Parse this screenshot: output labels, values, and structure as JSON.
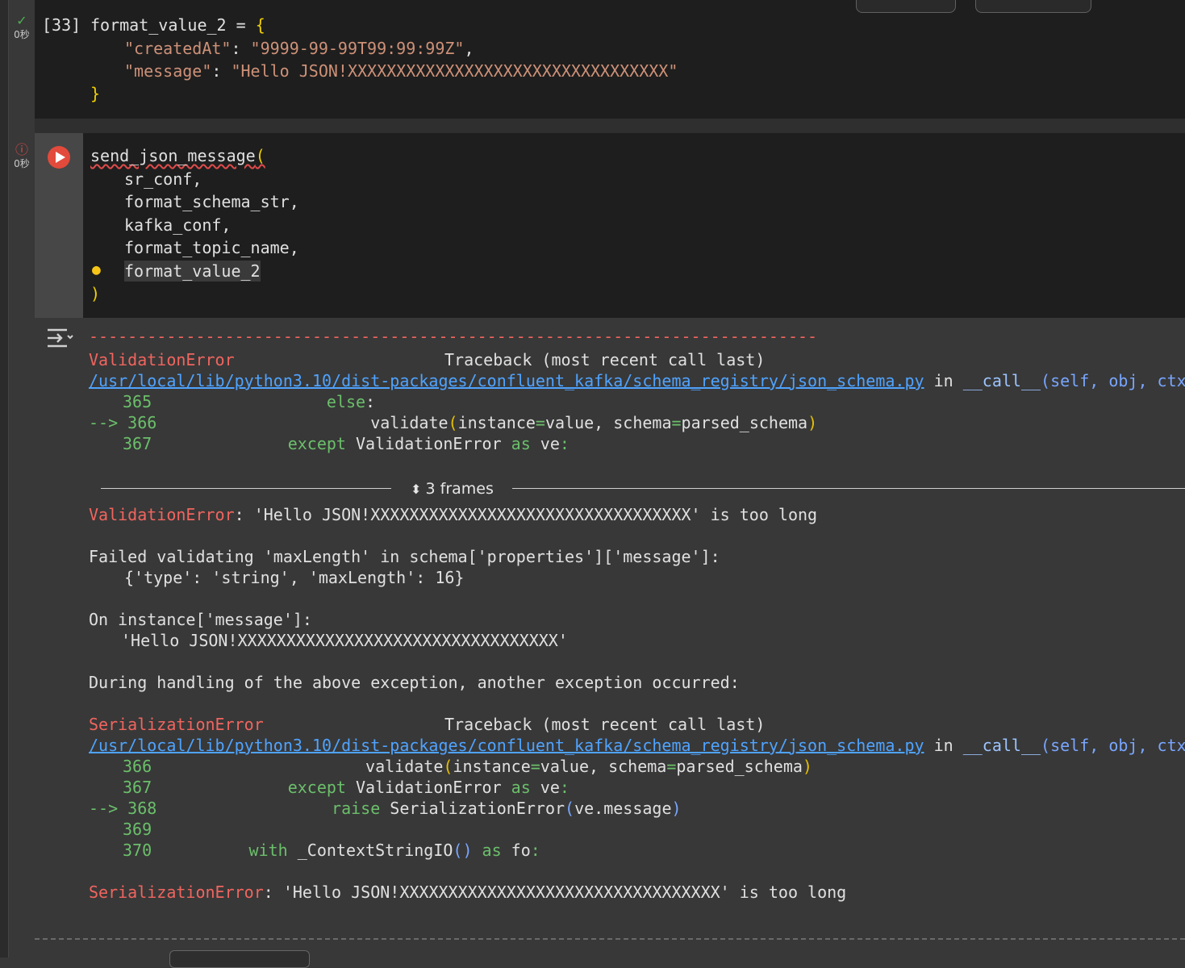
{
  "cell1": {
    "exec_count": "[33]",
    "time": "0秒",
    "lines": [
      "format_value_2 = {",
      "\"createdAt\": \"9999-99-99T99:99:99Z\",",
      "\"message\": \"Hello JSON!XXXXXXXXXXXXXXXXXXXXXXXXXXXXXXXXX\"",
      "}"
    ]
  },
  "cell2": {
    "time": "0秒",
    "call": "send_json_message(",
    "args": [
      "sr_conf,",
      "format_schema_str,",
      "kafka_conf,",
      "format_topic_name,",
      "format_value_2"
    ],
    "close": ")"
  },
  "output": {
    "dashes": "---------------------------------------------------------------------------",
    "err1_name": "ValidationError",
    "traceback_label": "Traceback (most recent call last)",
    "path": "/usr/local/lib/python3.10/dist-packages/confluent_kafka/schema_registry/json_schema.py",
    "in": "in",
    "call_fn": "__call__",
    "call_args": "(self, obj, ctx)",
    "tb1": [
      {
        "arrow": "",
        "num": "365",
        "text": "else:"
      },
      {
        "arrow": "-->",
        "num": "366",
        "text": "validate(instance=value, schema=parsed_schema)"
      },
      {
        "arrow": "",
        "num": "367",
        "text": "except ValidationError as ve:"
      }
    ],
    "frames_label": "3 frames",
    "err1_msg": ": 'Hello JSON!XXXXXXXXXXXXXXXXXXXXXXXXXXXXXXXXX' is too long",
    "failed_line": "Failed validating 'maxLength' in schema['properties']['message']:",
    "schema_line": "{'type': 'string', 'maxLength': 16}",
    "instance_line": "On instance['message']:",
    "instance_value": "'Hello JSON!XXXXXXXXXXXXXXXXXXXXXXXXXXXXXXXXX'",
    "during": "During handling of the above exception, another exception occurred:",
    "err2_name": "SerializationError",
    "tb2": [
      {
        "arrow": "",
        "num": "366",
        "text": "validate(instance=value, schema=parsed_schema)"
      },
      {
        "arrow": "",
        "num": "367",
        "text": "except ValidationError as ve:"
      },
      {
        "arrow": "-->",
        "num": "368",
        "text": "raise SerializationError(ve.message)"
      },
      {
        "arrow": "",
        "num": "369",
        "text": ""
      },
      {
        "arrow": "",
        "num": "370",
        "text": "with _ContextStringIO() as fo:"
      }
    ],
    "err2_msg": ": 'Hello JSON!XXXXXXXXXXXXXXXXXXXXXXXXXXXXXXXXX' is too long"
  },
  "colors": {
    "error_red": "#f0655f",
    "link_blue": "#4fa3ff",
    "keyword_green": "#6bbf6b",
    "string_orange": "#ce9178"
  }
}
